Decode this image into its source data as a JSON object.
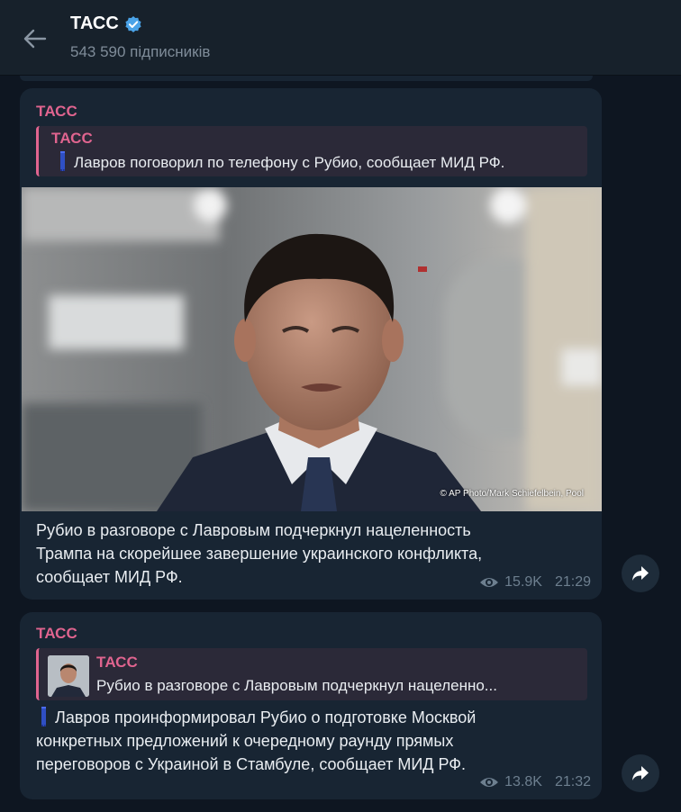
{
  "header": {
    "title": "ТАСС",
    "subscribers": "543 590 підписників"
  },
  "messages": [
    {
      "sender": "ТАСС",
      "reply": {
        "sender": "ТАСС",
        "text": "Лавров поговорил по телефону с Рубио, сообщает МИД РФ."
      },
      "photo_credit": "© AP Photo/Mark Schiefelbein, Pool",
      "text_lines": [
        "Рубио в разговоре с Лавровым подчеркнул нацеленность",
        "Трампа на скорейшее завершение украинского конфликта,",
        "сообщает МИД РФ."
      ],
      "views": "15.9K",
      "time": "21:29"
    },
    {
      "sender": "ТАСС",
      "reply": {
        "sender": "ТАСС",
        "text": "Рубио в разговоре с Лавровым подчеркнул нацеленно..."
      },
      "text_lines": [
        "Лавров проинформировал Рубио о подготовке Москвой",
        "конкретных предложений к очередному раунду прямых",
        "переговоров с Украиной в Стамбуле, сообщает МИД РФ."
      ],
      "views": "13.8K",
      "time": "21:32"
    }
  ],
  "colors": {
    "background": "#0e1621",
    "header": "#17212b",
    "bubble": "#182533",
    "accent": "#e0648f",
    "meta": "#6d7f8f"
  },
  "icons": [
    "back-arrow-icon",
    "verified-badge-icon",
    "eye-icon",
    "forward-icon"
  ]
}
